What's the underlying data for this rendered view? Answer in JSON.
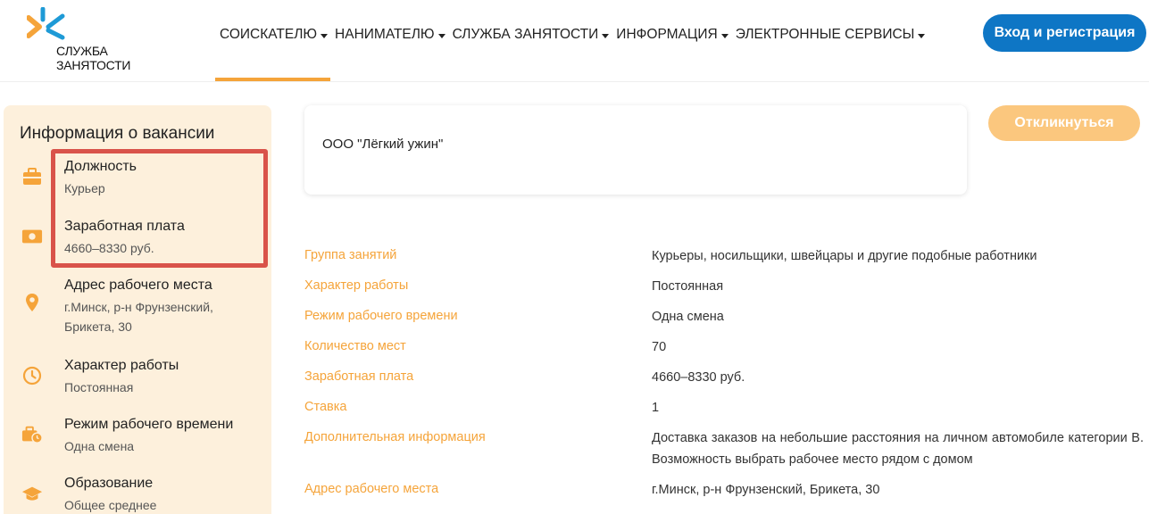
{
  "header": {
    "logo_text_line1": "СЛУЖБА",
    "logo_text_line2": "ЗАНЯТОСТИ",
    "nav": [
      {
        "label": "СОИСКАТЕЛЮ"
      },
      {
        "label": "НАНИМАТЕЛЮ"
      },
      {
        "label": "СЛУЖБА ЗАНЯТОСТИ"
      },
      {
        "label": "ИНФОРМАЦИЯ"
      },
      {
        "label": "ЭЛЕКТРОННЫЕ СЕРВИСЫ"
      }
    ],
    "login_label": "Вход и регистрация"
  },
  "colors": {
    "accent": "#f5a43a",
    "primary": "#0e76c5",
    "sidebar_bg": "#fdf0dc",
    "highlight": "#d9534a"
  },
  "sidebar": {
    "title": "Информация о вакансии",
    "items": [
      {
        "icon": "briefcase-icon",
        "label": "Должность",
        "value": "Курьер"
      },
      {
        "icon": "money-icon",
        "label": "Заработная плата",
        "value": "4660–8330 руб."
      },
      {
        "icon": "location-pin-icon",
        "label": "Адрес рабочего места",
        "value_line1": "г.Минск, р-н Фрунзенский,",
        "value_line2": "Брикета, 30"
      },
      {
        "icon": "clock-icon",
        "label": "Характер работы",
        "value": "Постоянная"
      },
      {
        "icon": "briefcase-clock-icon",
        "label": "Режим рабочего времени",
        "value": "Одна смена"
      },
      {
        "icon": "graduation-cap-icon",
        "label": "Образование",
        "value": "Общее среднее"
      }
    ]
  },
  "main": {
    "company_name": "ООО \"Лёгкий ужин\"",
    "respond_label": "Откликнуться",
    "details": [
      {
        "label": "Группа занятий",
        "value": "Курьеры, носильщики, швейцары и другие подобные работники"
      },
      {
        "label": "Характер работы",
        "value": "Постоянная"
      },
      {
        "label": "Режим рабочего времени",
        "value": "Одна смена"
      },
      {
        "label": "Количество мест",
        "value": "70"
      },
      {
        "label": "Заработная плата",
        "value": "4660–8330 руб."
      },
      {
        "label": "Ставка",
        "value": "1"
      },
      {
        "label": "Дополнительная информация",
        "value": "Доставка заказов на небольшие расстояния на личном автомобиле категории В. Возможность выбрать рабочее место рядом с домом"
      },
      {
        "label": "Адрес рабочего места",
        "value": "г.Минск, р-н Фрунзенский, Брикета, 30"
      }
    ]
  }
}
